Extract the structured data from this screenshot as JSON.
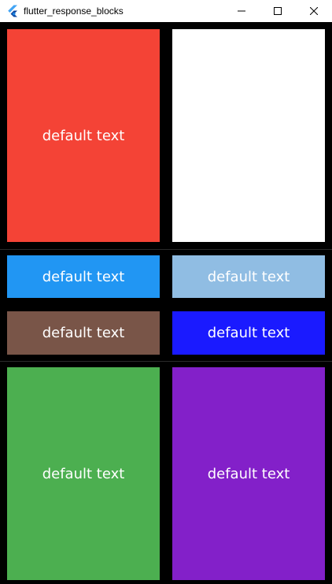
{
  "window": {
    "title": "flutter_response_blocks",
    "icon": "flutter-logo-icon",
    "controls": [
      "minimize-icon",
      "maximize-icon",
      "close-icon"
    ]
  },
  "blocks": [
    {
      "text": "default text",
      "color": "#f44336"
    },
    {
      "text": "",
      "color": "#ffffff"
    },
    {
      "text": "default text",
      "color": "#2196f3"
    },
    {
      "text": "default text",
      "color": "#90bde3"
    },
    {
      "text": "default text",
      "color": "#795548"
    },
    {
      "text": "default text",
      "color": "#1a1aff"
    },
    {
      "text": "default text",
      "color": "#4caf50"
    },
    {
      "text": "default text",
      "color": "#8320c9"
    }
  ]
}
